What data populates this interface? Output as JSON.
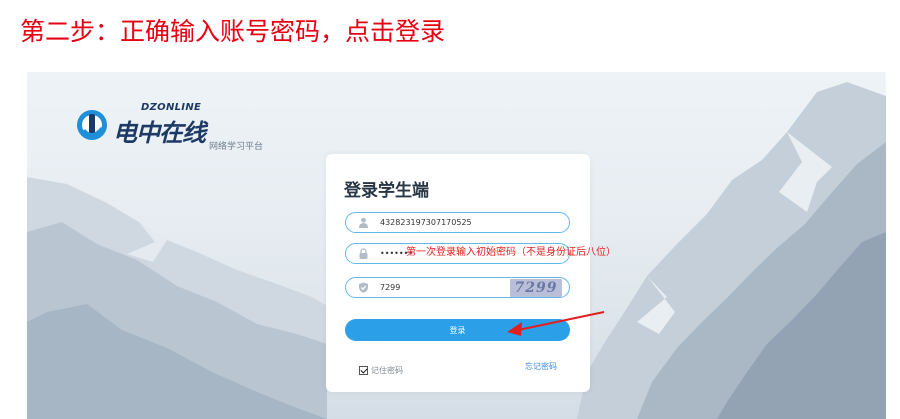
{
  "step_title": "第二步：正确输入账号密码，点击登录",
  "brand": {
    "english": "DZONLINE",
    "chinese": "电中在线",
    "subtitle": "网络学习平台",
    "logo_icon": "dz-logo-icon"
  },
  "login": {
    "title": "登录学生端",
    "username": {
      "value": "432823197307170525",
      "icon": "user-icon"
    },
    "password": {
      "value": "•••••••",
      "icon": "lock-icon"
    },
    "captcha": {
      "value": "7299",
      "icon": "shield-icon",
      "image_text": "7299"
    },
    "button": "登录",
    "remember_label": "记住密码",
    "remember_checked": true,
    "forgot_label": "忘记密码"
  },
  "annotation": "第一次登录输入初始密码（不是身份证后八位）",
  "colors": {
    "title_red": "#e60012",
    "annotation_red": "#e02020",
    "primary_blue": "#2b9fe8",
    "field_border": "#63b8ea",
    "brand_navy": "#1d3a66"
  }
}
